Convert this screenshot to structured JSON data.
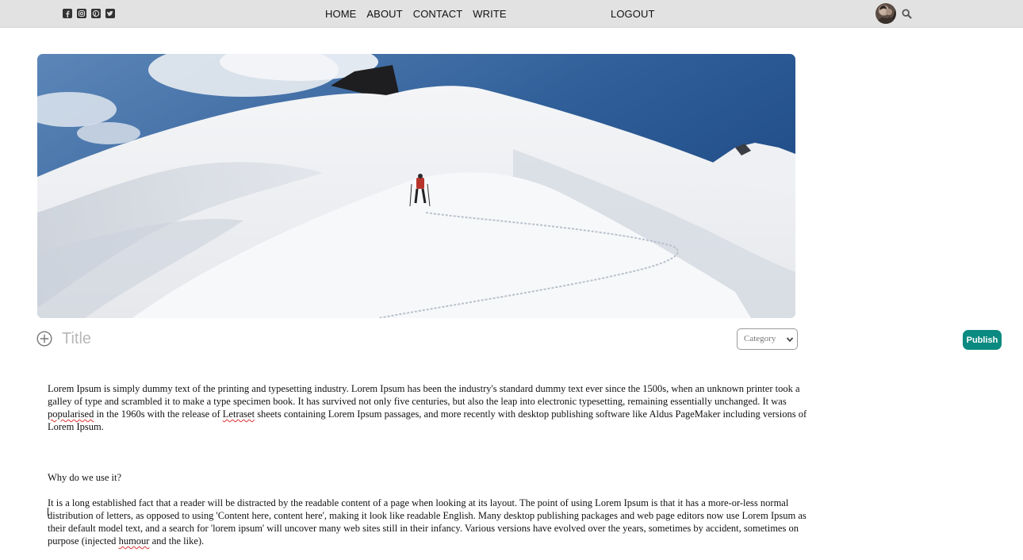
{
  "header": {
    "social_icons": [
      "facebook-square-icon",
      "instagram-icon",
      "pinterest-square-icon",
      "twitter-square-icon"
    ],
    "nav": [
      {
        "label": "HOME"
      },
      {
        "label": "ABOUT"
      },
      {
        "label": "CONTACT"
      },
      {
        "label": "WRITE"
      }
    ],
    "logout_label": "LOGOUT",
    "search_icon": "search-icon"
  },
  "editor": {
    "title_placeholder": "Title",
    "category_label": "Category",
    "publish_label": "Publish",
    "paragraph1_a": "Lorem Ipsum is simply dummy text of the printing and typesetting industry. Lorem Ipsum has been the industry's standard dummy text ever since the 1500s, when an unknown printer took a galley of type and scrambled it to make a type specimen book. It has survived not only five centuries, but also the leap into electronic typesetting, remaining essentially unchanged. It was ",
    "paragraph1_misspelled1": "popularised",
    "paragraph1_b": " in the 1960s with the release of ",
    "paragraph1_misspelled2": "Letraset",
    "paragraph1_c": " sheets containing Lorem Ipsum passages, and more recently with desktop publishing software like Aldus PageMaker including versions of Lorem Ipsum.",
    "heading2": "Why do we use it?",
    "paragraph2_a": "It is a long established fact that a reader will be distracted by the readable content of a page when looking at its layout. The point of using Lorem Ipsum is that it has a more-or-less normal distribution of letters, as opposed to using 'Content here, content here', making it look like readable English. Many desktop publishing packages and web page editors now use Lorem Ipsum as their default model text, and a search for 'lorem ipsum' will uncover many web sites still in their infancy. Various versions have evolved over the years, sometimes by accident, sometimes on purpose (injected ",
    "paragraph2_misspelled": "humour",
    "paragraph2_b": " and the like)."
  },
  "colors": {
    "topbar_bg": "#e2e2e2",
    "publish_bg": "#0a8a80"
  }
}
